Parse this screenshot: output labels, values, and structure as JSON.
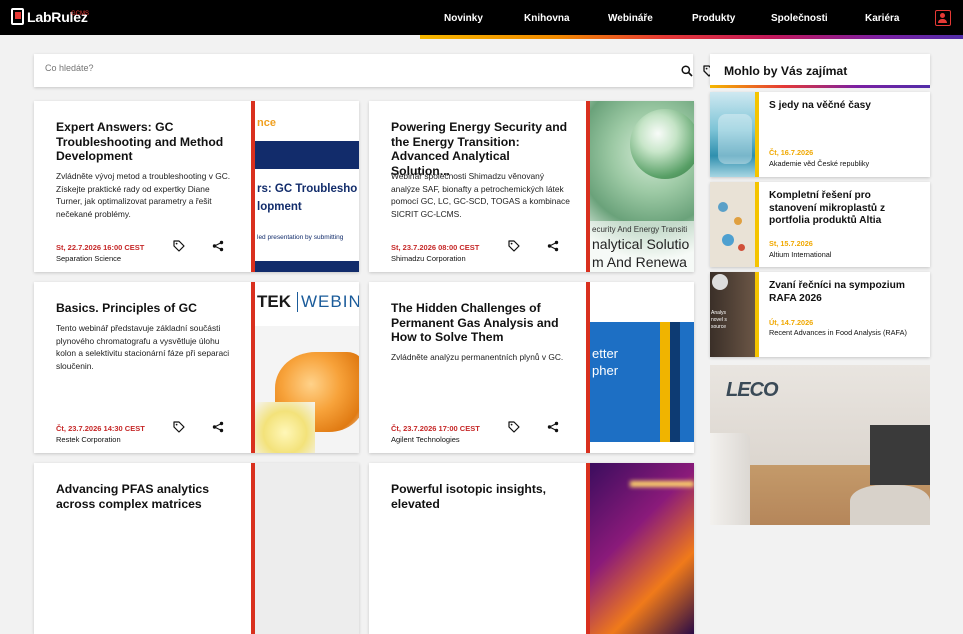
{
  "header": {
    "logo_text": "LabRulez",
    "logo_sup": "GCMS",
    "nav": [
      {
        "label": "Novinky"
      },
      {
        "label": "Knihovna"
      },
      {
        "label": "Webináře"
      },
      {
        "label": "Produkty"
      },
      {
        "label": "Společnosti"
      },
      {
        "label": "Kariéra"
      }
    ]
  },
  "search": {
    "placeholder": "Co hledáte?"
  },
  "cards": [
    {
      "title": "Expert Answers: GC Troubleshooting and Method Development",
      "desc": "Zvládněte vývoj metod a troubleshooting v GC. Získejte praktické rady od expertky Diane Turner, jak optimalizovat parametry a řešit nečekané problémy.",
      "date": "St, 22.7.2026 16:00 CEST",
      "org": "Separation Science",
      "img_line1": "nce",
      "img_line2": "rs: GC Troublesho",
      "img_line3": "lopment",
      "img_line4": "led presentation by submitting"
    },
    {
      "title": "Powering Energy Security and the Energy Transition: Advanced Analytical Solution...",
      "desc": "Webinář společnosti Shimadzu věnovaný analýze SAF, bionafty a petrochemických látek pomocí GC, LC, GC-SCD, TOGAS a kombinace SICRIT GC-LCMS.",
      "date": "St, 23.7.2026 08:00 CEST",
      "org": "Shimadzu Corporation",
      "img_line1": "ecurity And Energy Transiti",
      "img_line2": "nalytical Solutio",
      "img_line3": "m And Renewa"
    },
    {
      "title": "Basics. Principles of GC",
      "desc": "Tento webinář představuje základní součásti plynového chromatografu a vysvětluje úlohu kolon a selektivitu stacionární fáze při separaci sloučenin.",
      "date": "Čt, 23.7.2026 14:30 CEST",
      "org": "Restek Corporation",
      "img_line1": "TEK",
      "img_line2": "WEBINA"
    },
    {
      "title": "The Hidden Challenges of Permanent Gas Analysis and How to Solve Them",
      "desc": "Zvládněte analýzu permanentních plynů v GC.",
      "date": "Čt, 23.7.2026 17:00 CEST",
      "org": "Agilent Technologies",
      "img_line1": "etter",
      "img_line2": "pher"
    },
    {
      "title": "Advancing PFAS analytics across complex matrices"
    },
    {
      "title": "Powerful isotopic insights, elevated"
    }
  ],
  "sidebar": {
    "heading": "Mohlo by Vás zajímat",
    "items": [
      {
        "title": "S jedy na věčné časy",
        "date": "Čt, 16.7.2026",
        "org": "Akademie věd České republiky"
      },
      {
        "title": "Kompletní řešení pro stanovení mikroplastů z portfolia produktů Altia",
        "date": "St, 15.7.2026",
        "org": "Altium International"
      },
      {
        "title": "Zvaní řečníci na sympozium RAFA 2026",
        "date": "Út, 14.7.2026",
        "org": "Recent Advances in Food Analysis (RAFA)",
        "thumb_line1": "Analys",
        "thumb_line2": "novel s",
        "thumb_line3": "source"
      }
    ]
  },
  "ad": {
    "brand": "LECO"
  },
  "colors": {
    "accent_red": "#d9301e",
    "date_red": "#c62828",
    "sidebar_yellow": "#f5c400",
    "header_bg": "#000000",
    "page_bg": "#f2f2f2"
  }
}
